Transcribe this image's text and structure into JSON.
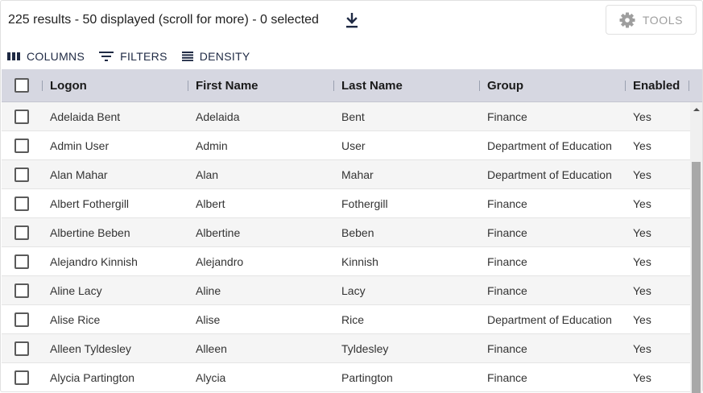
{
  "summary": {
    "text": "225 results - 50 displayed (scroll for more) - 0 selected"
  },
  "tools": {
    "label": "TOOLS"
  },
  "toolbar": {
    "columns_label": "COLUMNS",
    "filters_label": "FILTERS",
    "density_label": "DENSITY"
  },
  "table": {
    "headers": {
      "logon": "Logon",
      "first_name": "First Name",
      "last_name": "Last Name",
      "group": "Group",
      "enabled": "Enabled"
    },
    "rows": [
      {
        "logon": "Adelaida Bent",
        "first_name": "Adelaida",
        "last_name": "Bent",
        "group": "Finance",
        "enabled": "Yes"
      },
      {
        "logon": "Admin User",
        "first_name": "Admin",
        "last_name": "User",
        "group": "Department of Education",
        "enabled": "Yes"
      },
      {
        "logon": "Alan Mahar",
        "first_name": "Alan",
        "last_name": "Mahar",
        "group": "Department of Education",
        "enabled": "Yes"
      },
      {
        "logon": "Albert Fothergill",
        "first_name": "Albert",
        "last_name": "Fothergill",
        "group": "Finance",
        "enabled": "Yes"
      },
      {
        "logon": "Albertine Beben",
        "first_name": "Albertine",
        "last_name": "Beben",
        "group": "Finance",
        "enabled": "Yes"
      },
      {
        "logon": "Alejandro Kinnish",
        "first_name": "Alejandro",
        "last_name": "Kinnish",
        "group": "Finance",
        "enabled": "Yes"
      },
      {
        "logon": "Aline Lacy",
        "first_name": "Aline",
        "last_name": "Lacy",
        "group": "Finance",
        "enabled": "Yes"
      },
      {
        "logon": "Alise Rice",
        "first_name": "Alise",
        "last_name": "Rice",
        "group": "Department of Education",
        "enabled": "Yes"
      },
      {
        "logon": "Alleen Tyldesley",
        "first_name": "Alleen",
        "last_name": "Tyldesley",
        "group": "Finance",
        "enabled": "Yes"
      },
      {
        "logon": "Alycia Partington",
        "first_name": "Alycia",
        "last_name": "Partington",
        "group": "Finance",
        "enabled": "Yes"
      }
    ]
  },
  "icons": {
    "download": "download-icon",
    "tools": "gear-icon",
    "columns": "columns-icon",
    "filters": "filter-icon",
    "density": "density-icon",
    "scroll_up": "chevron-up-icon"
  },
  "colors": {
    "header_bg": "#d6d7e1",
    "toolbar_text": "#1f2a44",
    "tools_text": "#9e9e9e",
    "alt_row": "#f5f5f5",
    "scroll_thumb": "#a8a8a8"
  }
}
